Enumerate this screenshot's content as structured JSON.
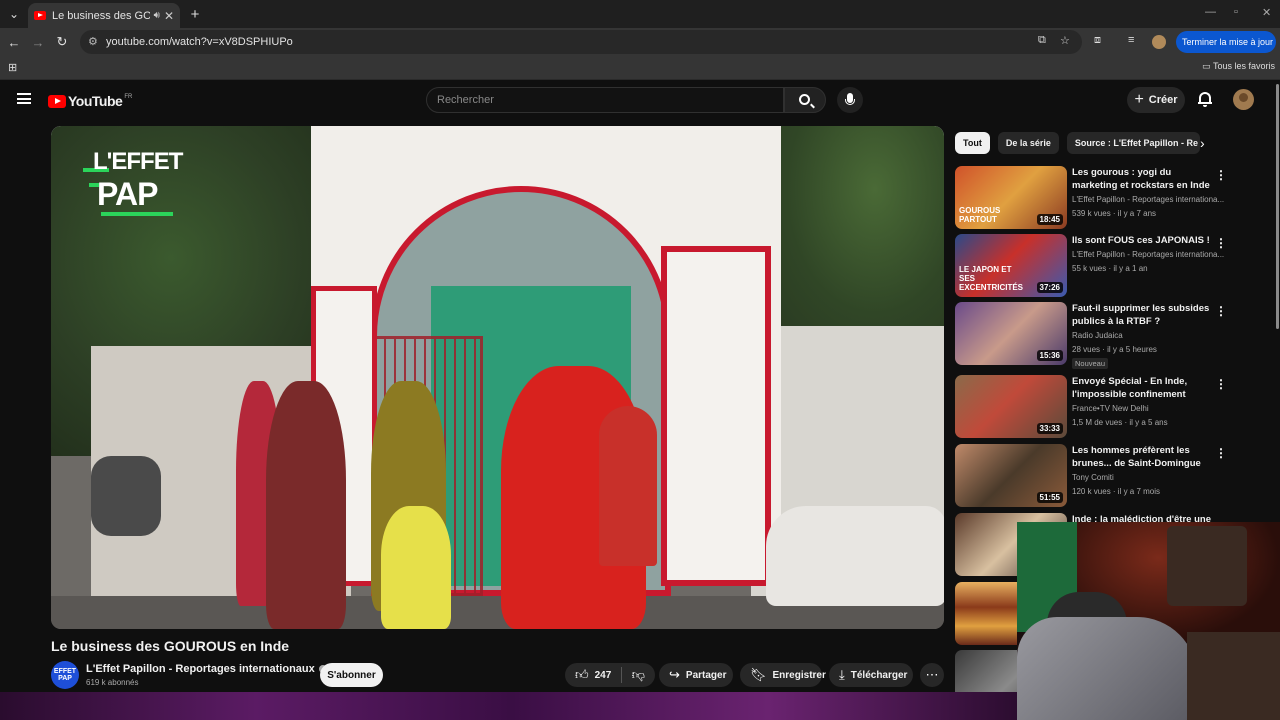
{
  "browser": {
    "tab_title": "Le business des GOUROUS",
    "url": "youtube.com/watch?v=xV8DSPHIUPo",
    "update_label": "Terminer la mise à jour",
    "bookmarks_all": "Tous les favoris"
  },
  "yt": {
    "logo": "YouTube",
    "region": "FR",
    "search_placeholder": "Rechercher",
    "create_label": "Créer"
  },
  "video": {
    "title": "Le business des GOUROUS en Inde",
    "overlay_logo_line1": "L'EFFET",
    "overlay_logo_line2": "PAP",
    "channel": "L'Effet Papillon - Reportages internationaux",
    "channel_avatar_text": "EFFET PAP",
    "subscribers": "619 k abonnés",
    "subscribe_label": "S'abonner",
    "likes": "247",
    "share_label": "Partager",
    "save_label": "Enregistrer",
    "download_label": "Télécharger"
  },
  "chips": [
    "Tout",
    "De la série",
    "Source : L'Effet Papillon - Re"
  ],
  "recommendations": [
    {
      "title": "Les gourous : yogi du marketing et rockstars en Inde",
      "channel": "L'Effet Papillon - Reportages internationa...",
      "meta": "539 k vues · il y a 7 ans",
      "duration": "18:45",
      "thumb_caption": "GOUROUS PARTOUT",
      "badge": ""
    },
    {
      "title": "Ils sont FOUS ces JAPONAIS !",
      "channel": "L'Effet Papillon - Reportages internationa...",
      "meta": "55 k vues · il y a 1 an",
      "duration": "37:26",
      "thumb_caption": "LE JAPON ET SES EXCENTRICITÉS",
      "badge": ""
    },
    {
      "title": "Faut-il supprimer les subsides publics à la RTBF ?",
      "channel": "Radio Judaica",
      "meta": "28 vues · il y a 5 heures",
      "duration": "15:36",
      "thumb_caption": "",
      "badge": "Nouveau"
    },
    {
      "title": "Envoyé Spécial - En Inde, l'impossible confinement",
      "channel": "France•TV New Delhi",
      "meta": "1,5 M de vues · il y a 5 ans",
      "duration": "33:33",
      "thumb_caption": "",
      "badge": ""
    },
    {
      "title": "Les hommes préfèrent les brunes... de Saint-Domingue",
      "channel": "Tony Comiti",
      "meta": "120 k vues · il y a 7 mois",
      "duration": "51:55",
      "thumb_caption": "",
      "badge": ""
    },
    {
      "title": "Inde : la malédiction d'être une",
      "channel": "",
      "meta": "",
      "duration": "",
      "thumb_caption": "",
      "badge": ""
    }
  ],
  "colors": {
    "yt_red": "#ff0000",
    "update_blue": "#0b57d0",
    "pap_green": "#2bd45a",
    "temple_red": "#c8192e"
  }
}
